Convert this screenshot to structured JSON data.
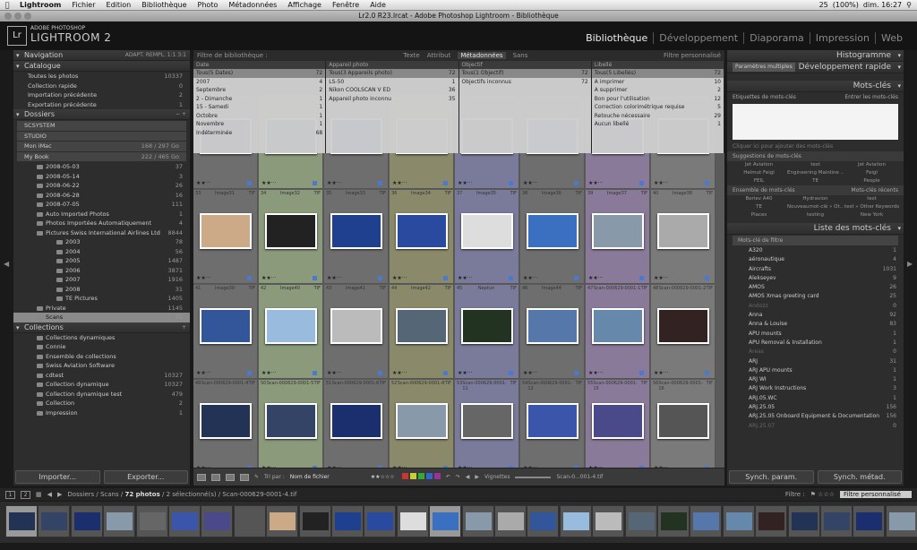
{
  "menubar": {
    "items": [
      "Lightroom",
      "Fichier",
      "Edition",
      "Bibliothèque",
      "Photo",
      "Métadonnées",
      "Affichage",
      "Fenêtre",
      "Aide"
    ],
    "status": [
      "25",
      "(100%)",
      "dim. 16:27"
    ]
  },
  "window": {
    "title": "Lr2.0 R23.lrcat - Adobe Photoshop Lightroom - Bibliothèque"
  },
  "brand": {
    "logo": "Lr",
    "line1": "ADOBE PHOTOSHOP",
    "line2": "LIGHTROOM 2"
  },
  "modules": [
    "Bibliothèque",
    "Développement",
    "Diaporama",
    "Impression",
    "Web"
  ],
  "left": {
    "navigator": {
      "title": "Navigation",
      "extra": "ADAPT.   REMPL.   1:1   3:1"
    },
    "catalog": {
      "title": "Catalogue",
      "items": [
        {
          "label": "Toutes les photos",
          "count": "10337"
        },
        {
          "label": "Collection rapide",
          "count": "0"
        },
        {
          "label": "Importation précédente",
          "count": "2"
        },
        {
          "label": "Exportation précédente",
          "count": "1"
        }
      ]
    },
    "folders": {
      "title": "Dossiers",
      "volumes": [
        {
          "label": "SCSYSTEM"
        },
        {
          "label": "STUDIO"
        },
        {
          "label": "Mon iMac",
          "count": "168 / 297 Go"
        },
        {
          "label": "My Book",
          "count": "222 / 465 Go"
        }
      ],
      "items": [
        {
          "label": "2008-05-03",
          "count": "37",
          "lvl": 1
        },
        {
          "label": "2008-05-14",
          "count": "3",
          "lvl": 1
        },
        {
          "label": "2008-06-22",
          "count": "26",
          "lvl": 1
        },
        {
          "label": "2008-06-28",
          "count": "16",
          "lvl": 1
        },
        {
          "label": "2008-07-05",
          "count": "111",
          "lvl": 1
        },
        {
          "label": "Auto Imported Photos",
          "count": "1",
          "lvl": 1
        },
        {
          "label": "Photos Importées Automatiquement",
          "count": "4",
          "lvl": 1
        },
        {
          "label": "Pictures Swiss International Airlines Ltd",
          "count": "8844",
          "lvl": 1
        },
        {
          "label": "2003",
          "count": "78",
          "lvl": 2
        },
        {
          "label": "2004",
          "count": "56",
          "lvl": 2
        },
        {
          "label": "2005",
          "count": "1487",
          "lvl": 2
        },
        {
          "label": "2006",
          "count": "3871",
          "lvl": 2
        },
        {
          "label": "2007",
          "count": "1916",
          "lvl": 2
        },
        {
          "label": "2008",
          "count": "31",
          "lvl": 2
        },
        {
          "label": "TE Pictures",
          "count": "1405",
          "lvl": 2
        },
        {
          "label": "Private",
          "count": "1145",
          "lvl": 1
        },
        {
          "label": "Scans",
          "count": "72",
          "lvl": 1,
          "sel": true
        }
      ]
    },
    "collections": {
      "title": "Collections",
      "items": [
        {
          "label": "Collections dynamiques",
          "count": ""
        },
        {
          "label": "Connie",
          "count": ""
        },
        {
          "label": "Ensemble de collections",
          "count": ""
        },
        {
          "label": "Swiss Aviation Software",
          "count": ""
        },
        {
          "label": "cdtest",
          "count": "10327"
        },
        {
          "label": "Collection dynamique",
          "count": "10327"
        },
        {
          "label": "Collection dynamique test",
          "count": "479"
        },
        {
          "label": "Collection",
          "count": "2"
        },
        {
          "label": "Impression",
          "count": "1"
        }
      ]
    },
    "buttons": {
      "import": "Importer...",
      "export": "Exporter..."
    }
  },
  "filter": {
    "title": "Filtre de bibliothèque :",
    "tabs": [
      "Texte",
      "Attribut",
      "Métadonnées",
      "Sans"
    ],
    "preset": "Filtre personnalisé",
    "columns": [
      {
        "head": "Date",
        "rows": [
          [
            "Tous(5 Dates)",
            "72"
          ],
          [
            "2007",
            "4"
          ],
          [
            "Septembre",
            "2"
          ],
          [
            "2 - Dimanche",
            "1"
          ],
          [
            "15 - Samedi",
            "1"
          ],
          [
            "Octobre",
            "1"
          ],
          [
            "Novembre",
            "1"
          ],
          [
            "Indéterminée",
            "68"
          ]
        ]
      },
      {
        "head": "Appareil photo",
        "rows": [
          [
            "Tous(3 Appareils photo)",
            "72"
          ],
          [
            "LS-50",
            "1"
          ],
          [
            "Nikon COOLSCAN V ED",
            "36"
          ],
          [
            "Appareil photo inconnu",
            "35"
          ]
        ]
      },
      {
        "head": "Objectif",
        "rows": [
          [
            "Tous(1 Objectif)",
            "72"
          ],
          [
            "Objectifs inconnus",
            "72"
          ]
        ]
      },
      {
        "head": "Libellé",
        "rows": [
          [
            "Tous(5 Libellés)",
            "72"
          ],
          [
            "A imprimer",
            "10"
          ],
          [
            "A supprimer",
            "2"
          ],
          [
            "Bon pour l'utilisation",
            "12"
          ],
          [
            "Correction colorimétrique requise",
            "5"
          ],
          [
            "Retouche nécessaire",
            "29"
          ],
          [
            "Aucun libellé",
            "1"
          ]
        ]
      }
    ]
  },
  "grid": {
    "rows": [
      {
        "cells": [
          [
            "",
            "",
            ""
          ],
          [
            "",
            "",
            ""
          ],
          [
            "",
            "",
            ""
          ],
          [
            "",
            "",
            ""
          ],
          [
            "",
            "",
            ""
          ],
          [
            "",
            "",
            ""
          ],
          [
            "",
            "",
            ""
          ],
          [
            "",
            "",
            ""
          ]
        ]
      },
      {
        "cells": [
          [
            "33",
            "Image31",
            "TIF"
          ],
          [
            "34",
            "Image32",
            "TIF"
          ],
          [
            "35",
            "Image33",
            "TIF"
          ],
          [
            "36",
            "Image34",
            "TIF"
          ],
          [
            "37",
            "Image35",
            "TIF"
          ],
          [
            "38",
            "Image36",
            "TIF"
          ],
          [
            "39",
            "Image37",
            "TIF"
          ],
          [
            "40",
            "Image38",
            "TIF"
          ]
        ]
      },
      {
        "cells": [
          [
            "41",
            "Image39",
            "TIF"
          ],
          [
            "42",
            "Image40",
            "TIF"
          ],
          [
            "43",
            "Image41",
            "TIF"
          ],
          [
            "44",
            "Image42",
            "TIF"
          ],
          [
            "45",
            "Neptun",
            "TIF"
          ],
          [
            "46",
            "Image44",
            "TIF"
          ],
          [
            "47",
            "Scan-000629-0001-1",
            "TIF"
          ],
          [
            "48",
            "Scan-000629-0001-2",
            "TIF"
          ]
        ]
      },
      {
        "cells": [
          [
            "49",
            "Scan-000629-0001-4",
            "TIF"
          ],
          [
            "50",
            "Scan-000629-0001-5",
            "TIF"
          ],
          [
            "51",
            "Scan-000629-0001-6",
            "TIF"
          ],
          [
            "52",
            "Scan-000629-0001-8",
            "TIF"
          ],
          [
            "53",
            "Scan-000629-0001-11",
            "TIF"
          ],
          [
            "54",
            "Scan-000629-0001-12",
            "TIF"
          ],
          [
            "55",
            "Scan-000629-0001-15",
            "TIF"
          ],
          [
            "56",
            "Scan-000629-0001-16",
            "TIF"
          ]
        ]
      }
    ]
  },
  "toolbar": {
    "sort_label": "Tri par :",
    "sort_value": "Nom de fichier",
    "thumbs": "Vignettes",
    "selected": "Scan-0...001-4.tif"
  },
  "right": {
    "histogram": "Histogramme",
    "quick_dev": "Développement rapide",
    "quick_dev_preset": "Paramètres multiples",
    "keywords": "Mots-clés",
    "kw_tags": "Etiquettes de mots-clés",
    "kw_enter": "Entrer les mots-clés",
    "kw_hint": "Cliquer ici pour ajouter des mots-clés",
    "suggest_title": "Suggestions de mots-clés",
    "suggest": [
      "Jet Aviation",
      "test",
      "Jet Aviation",
      "Helmut Feigl",
      "Engineering Mainline ...",
      "Feigl",
      "FEIL",
      "TE",
      "People"
    ],
    "set_title": "Ensemble de mots-clés",
    "set_value": "Mots-clés récents",
    "set": [
      "Beriev A40",
      "Hydravion",
      "test",
      "TE",
      "Nouveaumot-clé » Ot...",
      "test » Other Keywords",
      "Places",
      "testing",
      "New York"
    ],
    "list_title": "Liste des mots-clés",
    "list_filter": "Mots-clé de filtre",
    "list": [
      [
        "A320",
        "1"
      ],
      [
        "aéronautique",
        "4"
      ],
      [
        "Aircrafts",
        "1031"
      ],
      [
        "Alekseyev",
        "9"
      ],
      [
        "AMOS",
        "26"
      ],
      [
        "AMOS Xmas greeting card",
        "25"
      ],
      [
        "Andozz",
        "0"
      ],
      [
        "Anna",
        "92"
      ],
      [
        "Anna & Louise",
        "83"
      ],
      [
        "APU mounts",
        "1"
      ],
      [
        "APU Removal & Installation",
        "1"
      ],
      [
        "Areas",
        "0"
      ],
      [
        "ARJ",
        "31"
      ],
      [
        "ARJ APU mounts",
        "1"
      ],
      [
        "ARJ WI",
        "1"
      ],
      [
        "ARJ Work Instructions",
        "3"
      ],
      [
        "ARJ.05.WC",
        "1"
      ],
      [
        "ARJ.25.05",
        "156"
      ],
      [
        "ARJ.25.05 Onboard Equipment & Documentation",
        "156"
      ],
      [
        "ARJ.25.07",
        "0"
      ]
    ],
    "buttons": {
      "sync_params": "Synch. param.",
      "sync_meta": "Synch. métad."
    }
  },
  "stripbar": {
    "path": "Dossiers / Scans /",
    "count": "72 photos",
    "rest": "/ 2 sélectionné(s) / Scan-000629-0001-4.tif",
    "filter_label": "Filtre :",
    "filter_value": "Filtre personnalisé",
    "b1": "1",
    "b2": "2"
  }
}
